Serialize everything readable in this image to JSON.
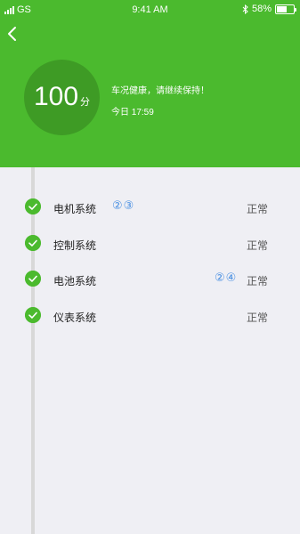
{
  "status_bar": {
    "carrier": "GS",
    "time": "9:41 AM",
    "battery": "58%",
    "battery_level": 0.58
  },
  "header": {
    "score_value": "100",
    "score_unit": "分",
    "health_message": "车况健康，请继续保持！",
    "time_label": "今日 17:59",
    "accent_color": "#4bba2e"
  },
  "systems": [
    {
      "name": "电机系统",
      "status": "正常",
      "codes": "②③"
    },
    {
      "name": "控制系统",
      "status": "正常",
      "codes": ""
    },
    {
      "name": "电池系统",
      "status": "正常",
      "codes": "②④"
    },
    {
      "name": "仪表系统",
      "status": "正常",
      "codes": ""
    }
  ]
}
